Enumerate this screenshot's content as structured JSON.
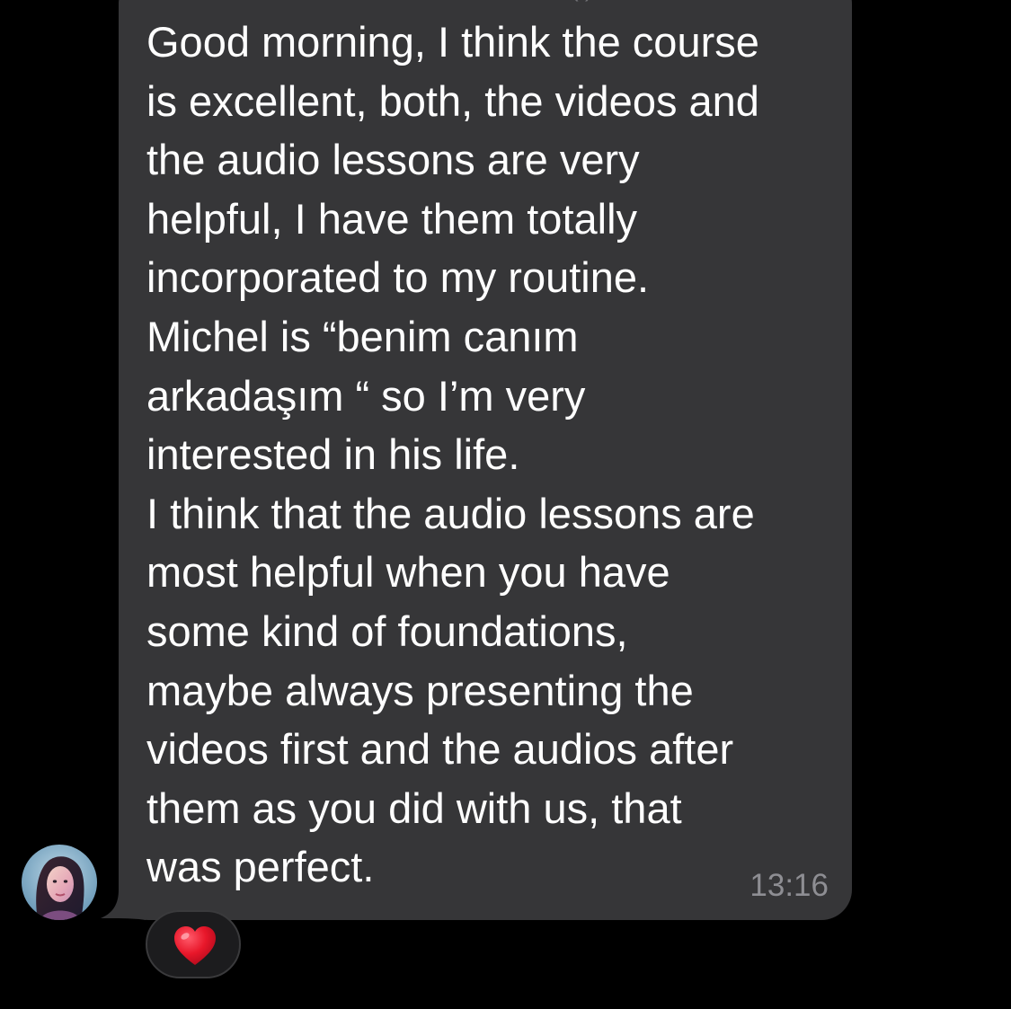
{
  "message": {
    "lines": [
      "Good morning, I think the course",
      "is excellent, both, the videos and",
      "the audio lessons are very",
      "helpful, I have them totally",
      "incorporated to my routine.",
      "Michel is “benim canım",
      "arkadaşım “ so I’m very",
      "interested in his life.",
      "I think that the audio lessons are",
      "most helpful when you have",
      "some kind of foundations,",
      "maybe always presenting the",
      "videos first and the audios after",
      "them as you did with us, that",
      "was perfect."
    ],
    "timestamp": "13:16"
  },
  "header_partial": {
    "trailing_text": "(  )"
  },
  "reaction": {
    "icon": "red-heart-icon"
  },
  "avatar": {
    "icon": "user-avatar-photo"
  },
  "colors": {
    "background": "#000000",
    "bubble": "#363638",
    "text": "#ffffff",
    "timestamp": "#8e8e93",
    "reaction_pill": "#1c1c1e",
    "heart": "#e8172a"
  }
}
